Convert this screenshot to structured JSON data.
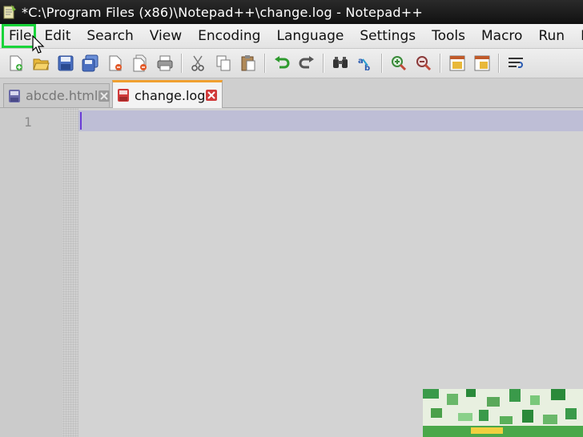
{
  "window": {
    "title": "*C:\\Program Files (x86)\\Notepad++\\change.log - Notepad++"
  },
  "menu": {
    "items": [
      "File",
      "Edit",
      "Search",
      "View",
      "Encoding",
      "Language",
      "Settings",
      "Tools",
      "Macro",
      "Run",
      "Plu"
    ],
    "highlighted": "File"
  },
  "toolbar": {
    "buttons": [
      "new-file-icon",
      "open-file-icon",
      "save-icon",
      "save-all-icon",
      "close-icon",
      "close-all-icon",
      "print-icon",
      "cut-icon",
      "copy-icon",
      "paste-icon",
      "undo-icon",
      "redo-icon",
      "find-icon",
      "replace-icon",
      "zoom-in-icon",
      "zoom-out-icon",
      "sync-vertical-icon",
      "sync-horizontal-icon",
      "word-wrap-icon"
    ]
  },
  "tabs": [
    {
      "label": "abcde.html",
      "state": "inactive",
      "icon": "saved-document-icon",
      "color": "#6a6aa8"
    },
    {
      "label": "change.log",
      "state": "active",
      "icon": "unsaved-document-icon",
      "color": "#d03a3a"
    }
  ],
  "editor": {
    "line_numbers": [
      "1"
    ],
    "current_line_color": "#bebed6",
    "content": ""
  },
  "colors": {
    "highlight_outline": "#19d43a",
    "active_tab_accent": "#f0a030"
  }
}
